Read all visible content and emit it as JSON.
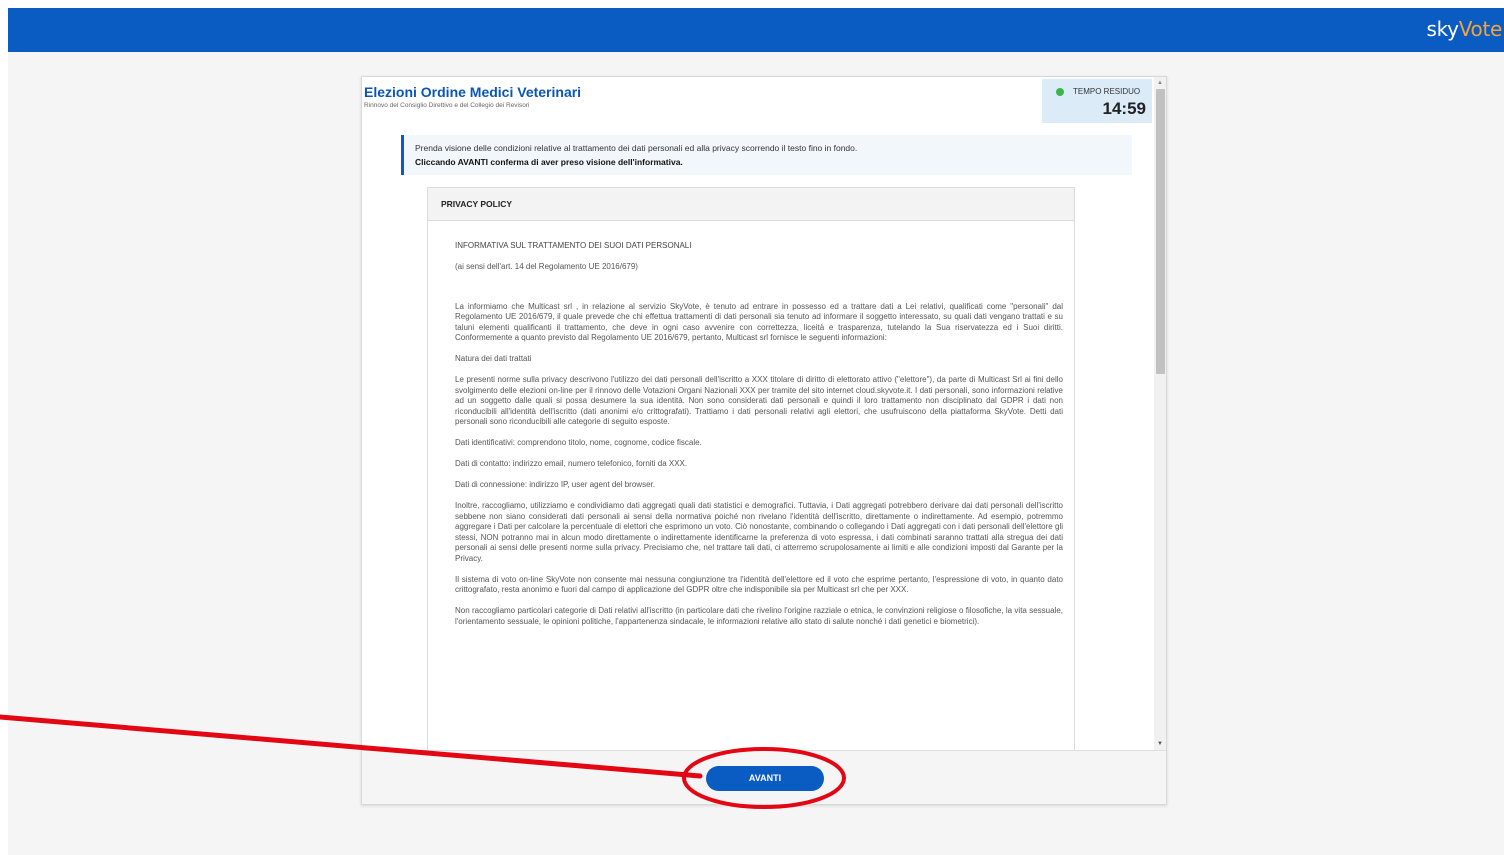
{
  "header": {
    "brand_part1": "sky",
    "brand_part2": "Vote",
    "bar_color": "#0a5cc2",
    "accent_color": "#f4a43a"
  },
  "election": {
    "title": "Elezioni Ordine Medici Veterinari",
    "subtitle": "Rinnovo del Consiglio Direttivo e del Collegio dei Revisori"
  },
  "timer": {
    "label": "TEMPO RESIDUO",
    "value": "14:59",
    "status_color": "#3bb54a"
  },
  "notice": {
    "line1": "Prenda visione delle condizioni relative al trattamento dei dati personali ed alla privacy scorrendo il testo fino in fondo.",
    "line2": "Cliccando AVANTI conferma di aver preso visione dell'informativa."
  },
  "policy": {
    "heading": "PRIVACY POLICY",
    "paragraphs": [
      "INFORMATIVA SUL TRATTAMENTO DEI SUOI DATI PERSONALI",
      "(ai sensi dell'art. 14 del Regolamento UE 2016/679)",
      "La informiamo che Multicast srl , in relazione al servizio SkyVote, è tenuto ad entrare in possesso ed a trattare dati a Lei relativi, qualificati come \"personali\" dal Regolamento UE 2016/679, il quale prevede che chi effettua trattamenti di dati personali sia tenuto ad informare il soggetto interessato, su quali dati vengano trattati e su taluni elementi qualificanti il trattamento, che deve in ogni caso avvenire con correttezza, liceità e trasparenza, tutelando la Sua riservatezza ed i Suoi diritti. Conformemente a quanto previsto dal Regolamento UE 2016/679, pertanto, Multicast srl fornisce le seguenti informazioni:",
      "Natura dei dati trattati",
      "Le presenti norme sulla privacy descrivono l'utilizzo dei dati personali dell'iscritto a XXX titolare di diritto di elettorato attivo (\"elettore\"), da parte di Multicast Srl ai fini dello svolgimento delle elezioni on-line per il rinnovo delle Votazioni Organi Nazionali XXX per tramite del sito internet cloud.skyvote.it. I dati personali, sono informazioni relative ad un soggetto dalle quali si possa desumere la sua identità. Non sono considerati dati personali e quindi il loro trattamento non disciplinato dal GDPR i dati non riconducibili all'identità dell'iscritto (dati anonimi e/o crittografati). Trattiamo i dati personali relativi agli elettori, che usufruiscono della piattaforma SkyVote. Detti dati personali sono riconducibili alle categorie di seguito esposte.",
      "Dati identificativi: comprendono titolo, nome, cognome, codice fiscale.",
      "Dati di contatto: indirizzo email, numero telefonico, forniti da XXX.",
      "Dati di connessione: indirizzo IP, user agent del browser.",
      "Inoltre, raccogliamo, utilizziamo e condividiamo dati aggregati quali dati statistici e demografici. Tuttavia, i Dati aggregati potrebbero derivare dai dati personali dell'iscritto sebbene non siano considerati dati personali ai sensi della normativa poiché non rivelano l'identità dell'iscritto, direttamente o indirettamente. Ad esempio, potremmo aggregare i Dati per calcolare la percentuale di elettori che esprimono un voto. Ciò nonostante, combinando o collegando i Dati aggregati con i dati personali dell'elettore gli stessi, NON potranno mai in alcun modo direttamente o indirettamente identificarne la preferenza di voto espressa, i dati combinati saranno trattati alla stregua dei dati personali ai sensi delle presenti norme sulla privacy. Precisiamo che, nel trattare tali dati, ci atterremo scrupolosamente ai limiti e alle condizioni imposti dal Garante per la Privacy.",
      "Il sistema di voto on-line SkyVote non consente mai nessuna congiunzione tra l'identità dell'elettore ed il voto che esprime pertanto, l'espressione di voto, in quanto dato crittografato, resta anonimo e fuori dal campo di applicazione del GDPR oltre che indisponibile sia per Multicast srl che per XXX.",
      "Non raccogliamo particolari categorie di Dati relativi all'iscritto (in particolare dati che rivelino l'origine razziale o etnica, le convinzioni religiose o filosofiche, la vita sessuale, l'orientamento sessuale, le opinioni politiche, l'appartenenza sindacale, le informazioni relative allo stato di salute nonché i dati genetici e biometrici)."
    ]
  },
  "footer": {
    "next_label": "AVANTI"
  }
}
